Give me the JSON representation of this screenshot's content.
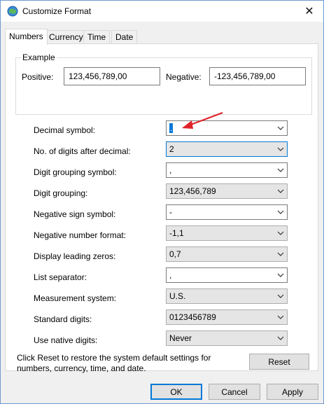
{
  "window": {
    "title": "Customize Format",
    "close_glyph": "✕"
  },
  "tabs": [
    {
      "label": "Numbers",
      "active": true
    },
    {
      "label": "Currency",
      "active": false
    },
    {
      "label": "Time",
      "active": false
    },
    {
      "label": "Date",
      "active": false
    }
  ],
  "example": {
    "group_label": "Example",
    "positive_label": "Positive:",
    "positive_value": "123,456,789,00",
    "negative_label": "Negative:",
    "negative_value": "-123,456,789,00"
  },
  "settings": [
    {
      "label": "Decimal symbol:",
      "value": ".",
      "editable": true,
      "focused": false
    },
    {
      "label": "No. of digits after decimal:",
      "value": "2",
      "editable": false,
      "focused": true
    },
    {
      "label": "Digit grouping symbol:",
      "value": ",",
      "editable": true,
      "focused": false
    },
    {
      "label": "Digit grouping:",
      "value": "123,456,789",
      "editable": false,
      "focused": false
    },
    {
      "label": "Negative sign symbol:",
      "value": "-",
      "editable": true,
      "focused": false
    },
    {
      "label": "Negative number format:",
      "value": "-1,1",
      "editable": false,
      "focused": false
    },
    {
      "label": "Display leading zeros:",
      "value": "0,7",
      "editable": false,
      "focused": false
    },
    {
      "label": "List separator:",
      "value": ",",
      "editable": true,
      "focused": false
    },
    {
      "label": "Measurement system:",
      "value": "U.S.",
      "editable": false,
      "focused": false
    },
    {
      "label": "Standard digits:",
      "value": "0123456789",
      "editable": false,
      "focused": false
    },
    {
      "label": "Use native digits:",
      "value": "Never",
      "editable": false,
      "focused": false
    }
  ],
  "reset": {
    "note": "Click Reset to restore the system default settings for numbers, currency, time, and date.",
    "button_label": "Reset"
  },
  "footer": {
    "ok_label": "OK",
    "cancel_label": "Cancel",
    "apply_label": "Apply"
  },
  "colors": {
    "accent": "#0078d7",
    "annotation_arrow": "#e0232a"
  }
}
